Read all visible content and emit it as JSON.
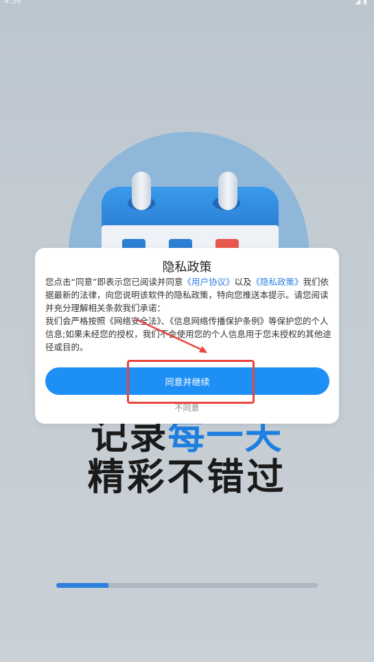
{
  "status_bar": {
    "time": "4:36",
    "icons": "◢ ▮"
  },
  "background": {
    "slogan_line1_prefix": "记录",
    "slogan_line1_accent": "每一天",
    "slogan_line2": "精彩不错过",
    "progress": 0.2
  },
  "dialog": {
    "title": "隐私政策",
    "paragraph1_a": "您点击“同意”即表示您已阅读并同意",
    "user_agreement_link": "《用户协议》",
    "paragraph1_b": "以及",
    "privacy_link": "《隐私政策》",
    "paragraph1_c": "我们依据最新的法律，向您说明该软件的隐私政策，特向您推送本提示。请您阅读并充分理解相关条款我们承诺：",
    "paragraph2": "我们会严格按照《网络安全法》、《信息网络传播保护条例》等保护您的个人信息;如果未经您的授权，我们不会使用您的个人信息用于您未授权的其他途径或目的。",
    "agree_label": "同意并继续",
    "disagree_label": "不同意"
  },
  "colors": {
    "accent": "#1e8ff5",
    "link": "#2d7fe0",
    "annotation": "#e8463c"
  }
}
